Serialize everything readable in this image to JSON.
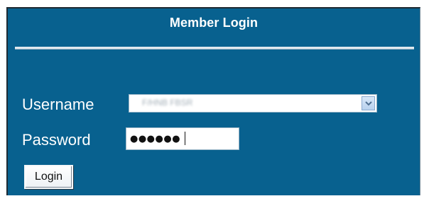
{
  "login_panel": {
    "title": "Member Login",
    "username_label": "Username",
    "password_label": "Password",
    "username_selected_value": "F/HNB FBSR",
    "password_mask": "●●●●●●",
    "login_button_label": "Login"
  },
  "icons": {
    "dropdown_arrow": "chevron-down-icon"
  },
  "colors": {
    "panel_background": "#08618f",
    "panel_text": "#ffffff",
    "field_background": "#ffffff"
  }
}
